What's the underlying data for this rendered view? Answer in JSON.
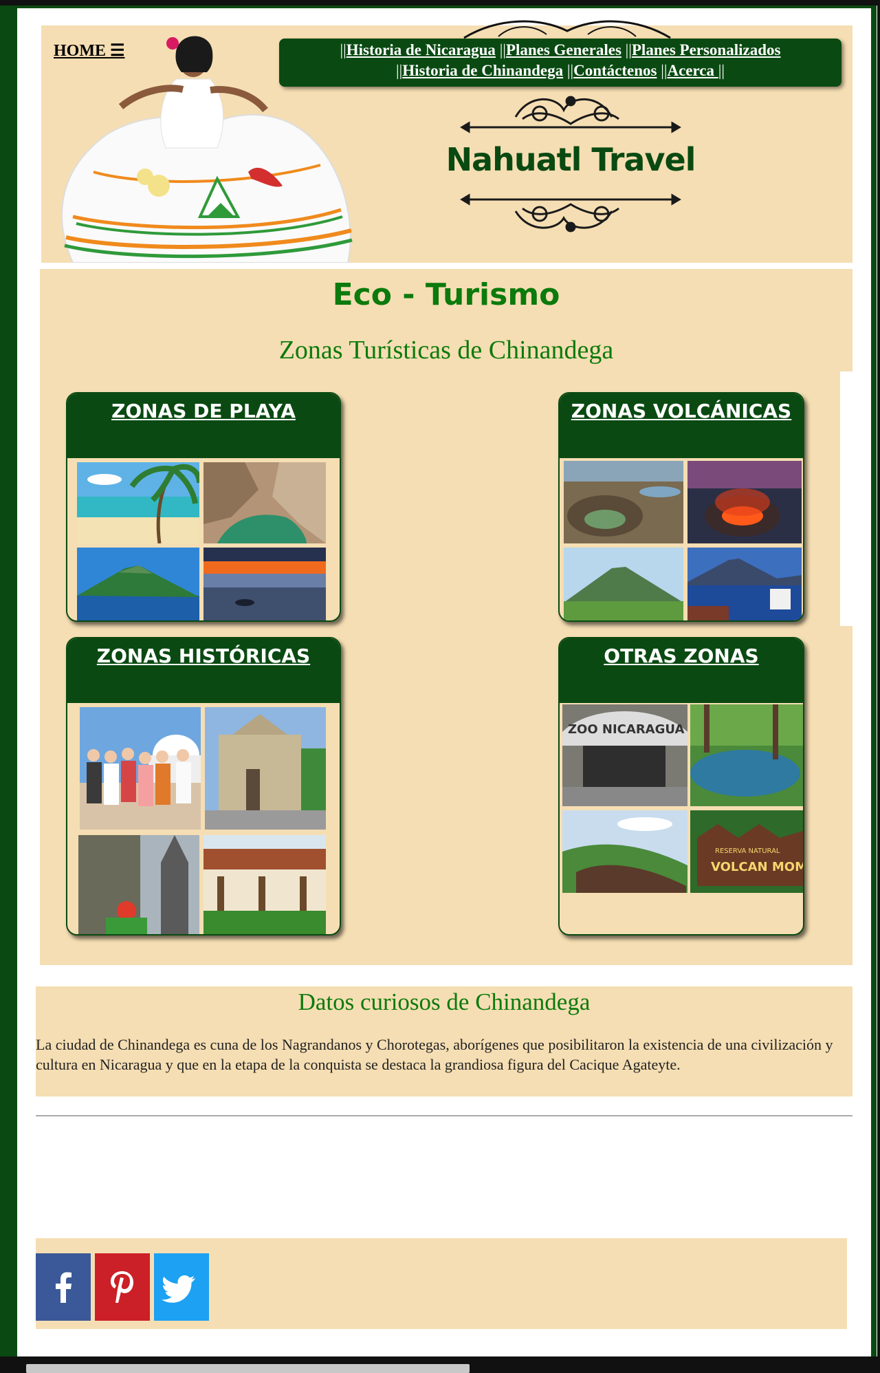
{
  "header": {
    "home_label": "HOME ☰",
    "brand": "Nahuatl Travel",
    "nav": [
      {
        "label": "Historia de Nicaragua"
      },
      {
        "label": "Planes Generales"
      },
      {
        "label": "Planes Personalizados"
      },
      {
        "label": "Historia de Chinandega"
      },
      {
        "label": "Contáctenos"
      },
      {
        "label": "Acerca "
      }
    ],
    "separator": "||"
  },
  "eco": {
    "title": "Eco - Turismo",
    "subtitle": "Zonas Turísticas de Chinandega",
    "zones": [
      {
        "title": "ZONAS DE PLAYA"
      },
      {
        "title": "ZONAS VOLCÁNICAS"
      },
      {
        "title": "ZONAS HISTÓRICAS"
      },
      {
        "title": "OTRAS ZONAS"
      }
    ]
  },
  "datos": {
    "title": "Datos curiosos de Chinandega",
    "text": "La ciudad de Chinandega es cuna de los Nagrandanos y Chorotegas, aborígenes que posibilitaron la existencia de una civilización y cultura en Nicaragua y que en la etapa de la conquista se destaca la grandiosa figura del Cacique Agateyte."
  },
  "photo_captions": {
    "zoo_sign": "ZOO NICARAGUA",
    "reserve_sign_top": "RESERVA NATURAL",
    "reserve_sign_main": "VOLCAN MOMBACH"
  },
  "social": [
    {
      "name": "facebook",
      "color": "#3b5998"
    },
    {
      "name": "pinterest",
      "color": "#cb2027"
    },
    {
      "name": "twitter",
      "color": "#1da1f2"
    }
  ],
  "colors": {
    "brand_green": "#0a4a12",
    "title_green": "#0c7a0c",
    "panel": "#f5deb3"
  }
}
